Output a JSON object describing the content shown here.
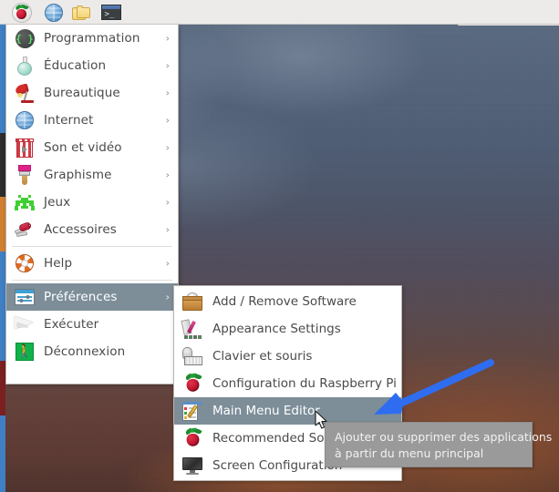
{
  "taskbar": {
    "items": [
      {
        "name": "raspberry-menu-button",
        "icon": "raspberry-icon",
        "label": "Menu"
      },
      {
        "name": "web-browser-button",
        "icon": "globe-icon",
        "label": "Web Browser"
      },
      {
        "name": "file-manager-button",
        "icon": "folders-icon",
        "label": "File Manager"
      },
      {
        "name": "terminal-button",
        "icon": "terminal-icon",
        "label": "Terminal"
      }
    ],
    "terminal_prompt": ">_"
  },
  "main_menu": {
    "items": [
      {
        "label": "Programmation",
        "icon": "code-braces-icon",
        "arrow": "›",
        "selected": false,
        "separator_after": false
      },
      {
        "label": "Éducation",
        "icon": "flask-icon",
        "arrow": "›",
        "selected": false,
        "separator_after": false
      },
      {
        "label": "Bureautique",
        "icon": "desk-lamp-icon",
        "arrow": "›",
        "selected": false,
        "separator_after": false
      },
      {
        "label": "Internet",
        "icon": "globe-icon",
        "arrow": "›",
        "selected": false,
        "separator_after": false
      },
      {
        "label": "Son et vidéo",
        "icon": "film-icon",
        "arrow": "›",
        "selected": false,
        "separator_after": false
      },
      {
        "label": "Graphisme",
        "icon": "paintbrush-icon",
        "arrow": "›",
        "selected": false,
        "separator_after": false
      },
      {
        "label": "Jeux",
        "icon": "space-invader-icon",
        "arrow": "›",
        "selected": false,
        "separator_after": false
      },
      {
        "label": "Accessoires",
        "icon": "pocket-knife-icon",
        "arrow": "›",
        "selected": false,
        "separator_after": true
      },
      {
        "label": "Help",
        "icon": "lifebuoy-icon",
        "arrow": "›",
        "selected": false,
        "separator_after": true
      },
      {
        "label": "Préférences",
        "icon": "sliders-icon",
        "arrow": "›",
        "selected": true,
        "separator_after": false
      },
      {
        "label": "Exécuter",
        "icon": "paper-plane-icon",
        "arrow": "",
        "selected": false,
        "separator_after": false
      },
      {
        "label": "Déconnexion",
        "icon": "exit-runner-icon",
        "arrow": "",
        "selected": false,
        "separator_after": false
      }
    ]
  },
  "submenu": {
    "parent": "Préférences",
    "items": [
      {
        "label": "Add / Remove Software",
        "icon": "software-case-icon",
        "selected": false
      },
      {
        "label": "Appearance Settings",
        "icon": "appearance-icon",
        "selected": false
      },
      {
        "label": "Clavier et souris",
        "icon": "keyboard-mouse-icon",
        "selected": false
      },
      {
        "label": "Configuration du Raspberry Pi",
        "icon": "raspberry-icon",
        "selected": false
      },
      {
        "label": "Main Menu Editor",
        "icon": "menu-editor-icon",
        "selected": true
      },
      {
        "label": "Recommended Software",
        "icon": "raspberry-icon",
        "selected": false
      },
      {
        "label": "Screen Configuration",
        "icon": "monitor-icon",
        "selected": false
      }
    ]
  },
  "tooltip": {
    "line1": "Ajouter ou supprimer des applications",
    "line2": "à partir du menu principal"
  },
  "annotation": {
    "type": "arrow",
    "color": "#2f6df0",
    "points_to": "Main Menu Editor"
  },
  "colors": {
    "menu_bg": "#ffffff",
    "menu_text": "#4a4a4a",
    "highlight_bg": "#7d8e99",
    "highlight_text": "#ffffff",
    "taskbar_bg": "#edebe9",
    "tooltip_bg": "#9a9a9a",
    "tooltip_text": "#f2f2f2",
    "arrow_blue": "#2f6df0"
  }
}
